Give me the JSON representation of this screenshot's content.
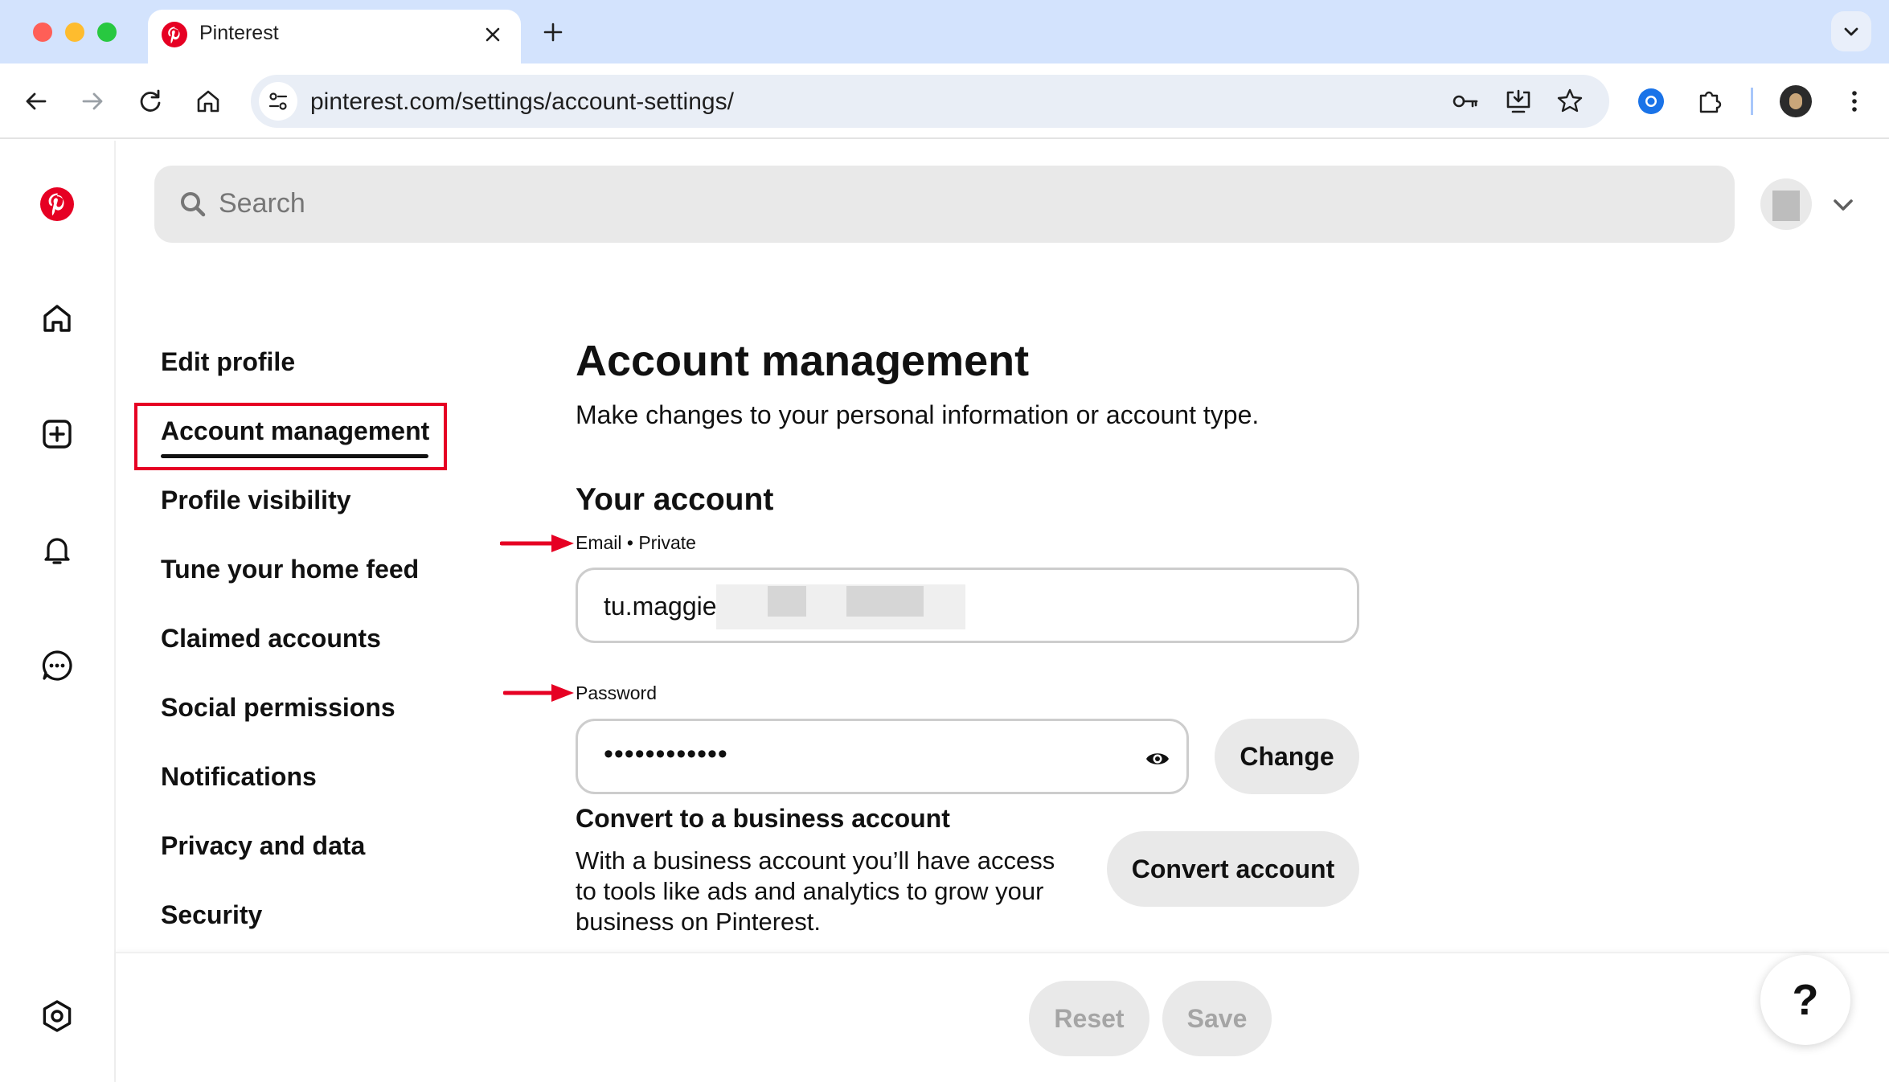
{
  "browser": {
    "tab_title": "Pinterest",
    "url": "pinterest.com/settings/account-settings/"
  },
  "search": {
    "placeholder": "Search"
  },
  "settings_nav": {
    "items": [
      {
        "label": "Edit profile"
      },
      {
        "label": "Account management",
        "active": true
      },
      {
        "label": "Profile visibility"
      },
      {
        "label": "Tune your home feed"
      },
      {
        "label": "Claimed accounts"
      },
      {
        "label": "Social permissions"
      },
      {
        "label": "Notifications"
      },
      {
        "label": "Privacy and data"
      },
      {
        "label": "Security"
      }
    ]
  },
  "main": {
    "title": "Account management",
    "subtitle": "Make changes to your personal information or account type.",
    "your_account": {
      "heading": "Your account",
      "email_label": "Email • Private",
      "email_value": "tu.maggie",
      "password_label": "Password",
      "password_value": "••••••••••••",
      "change_button": "Change"
    },
    "convert": {
      "title": "Convert to a business account",
      "description": "With a business account you’ll have access to tools like ads and analytics to grow your business on Pinterest.",
      "button": "Convert account"
    }
  },
  "footer": {
    "reset_button": "Reset",
    "save_button": "Save",
    "help_button": "?"
  },
  "colors": {
    "pinterest_red": "#e60023",
    "annotation_red": "#e60023",
    "tabstrip": "#d3e3fd",
    "pill_bg": "#e9e9e9"
  },
  "icons": {
    "rail": [
      "pinterest-logo-icon",
      "home-icon",
      "create-icon",
      "bell-icon",
      "messages-icon",
      "settings-icon"
    ],
    "browser": [
      "back-icon",
      "forward-icon",
      "reload-icon",
      "home-icon",
      "site-info-icon",
      "password-key-icon",
      "install-icon",
      "bookmark-star-icon",
      "extension-icon",
      "puzzle-icon",
      "profile-icon",
      "menu-icon"
    ]
  }
}
